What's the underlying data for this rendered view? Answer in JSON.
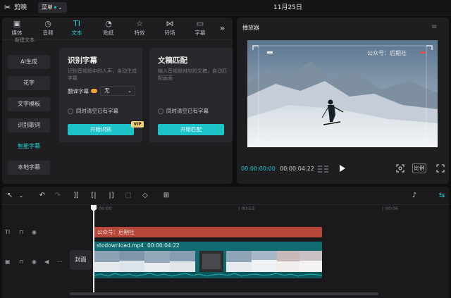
{
  "titlebar": {
    "app_name": "剪映",
    "menu_label": "菜单",
    "date": "11月25日"
  },
  "tabs": [
    {
      "label": "媒体",
      "icon": "media-icon"
    },
    {
      "label": "音频",
      "icon": "audio-icon"
    },
    {
      "label": "文本",
      "icon": "text-icon",
      "active": true
    },
    {
      "label": "贴纸",
      "icon": "sticker-icon"
    },
    {
      "label": "特效",
      "icon": "effects-icon"
    },
    {
      "label": "转场",
      "icon": "transition-icon"
    },
    {
      "label": "字幕",
      "icon": "subtitle-icon"
    }
  ],
  "text_subnav": {
    "top_partial": "新建文本",
    "items": [
      "AI生成",
      "花字",
      "文字模板",
      "识别歌词",
      "智能字幕",
      "本地字幕"
    ],
    "active": "智能字幕"
  },
  "recognize_card": {
    "title": "识别字幕",
    "desc": "识别音视频中的人声，自动生成字幕",
    "translate_label": "翻译字幕",
    "translate_value": "无",
    "clear_label": "同时清空已有字幕",
    "button": "开始识别",
    "vip": "VIP"
  },
  "script_card": {
    "title": "文稿匹配",
    "desc": "输入音视频对应的文稿，自动匹配画面",
    "clear_label": "同时清空已有字幕",
    "button": "开始匹配"
  },
  "player": {
    "title": "播放器",
    "watermark": "公众号：后期社",
    "current_time": "00:00:00:00",
    "total_time": "00:00:04:22",
    "ratio_label": "比例"
  },
  "timeline": {
    "ruler": [
      "00:00",
      "| 00:03",
      "| 00:06"
    ],
    "text_clip": "公众号：后期社",
    "video_clip_name": "stodownload.mp4",
    "video_clip_duration": "00:00:04:22",
    "cover_label": "封面"
  },
  "colors": {
    "accent": "#2ad1d6",
    "text_clip": "#b5483b",
    "video_clip": "#0f6b70"
  }
}
